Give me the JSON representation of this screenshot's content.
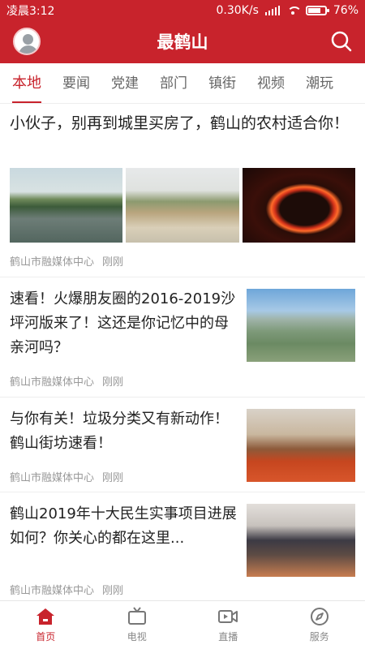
{
  "status_bar": {
    "time": "凌晨3:12",
    "net_speed": "0.30K/s",
    "battery_percent": "76%",
    "battery_level": 0.76
  },
  "header": {
    "title": "最鹤山",
    "icons": {
      "left": "avatar-icon",
      "right": "search-icon"
    }
  },
  "tabs": [
    {
      "label": "本地",
      "active": true
    },
    {
      "label": "要闻"
    },
    {
      "label": "党建"
    },
    {
      "label": "部门"
    },
    {
      "label": "镇街"
    },
    {
      "label": "视频"
    },
    {
      "label": "潮玩"
    }
  ],
  "articles": [
    {
      "title": "小伙子，别再到城里买房了，鹤山的农村适合你！",
      "source": "鹤山市融媒体中心",
      "time": "刚刚",
      "images": [
        "pond-village-photo",
        "old-building-photo",
        "fire-dragon-photo"
      ]
    },
    {
      "title": "速看！火爆朋友圈的2016-2019沙坪河版来了！这还是你记忆中的母亲河吗？",
      "source": "鹤山市融媒体中心",
      "time": "刚刚",
      "images": [
        "city-aerial-photo"
      ]
    },
    {
      "title": "与你有关！垃圾分类又有新动作！鹤山街坊速看！",
      "source": "鹤山市融媒体中心",
      "time": "刚刚",
      "images": [
        "meeting-hall-photo"
      ]
    },
    {
      "title": "鹤山2019年十大民生实事项目进展如何？你关心的都在这里...",
      "source": "鹤山市融媒体中心",
      "time": "刚刚",
      "images": [
        "meeting-table-photo"
      ]
    }
  ],
  "bottom_nav": [
    {
      "label": "首页",
      "icon": "home-icon",
      "active": true
    },
    {
      "label": "电视",
      "icon": "tv-icon"
    },
    {
      "label": "直播",
      "icon": "live-video-icon"
    },
    {
      "label": "服务",
      "icon": "compass-icon"
    }
  ],
  "colors": {
    "brand": "#c8232c",
    "muted_text": "#999999"
  }
}
